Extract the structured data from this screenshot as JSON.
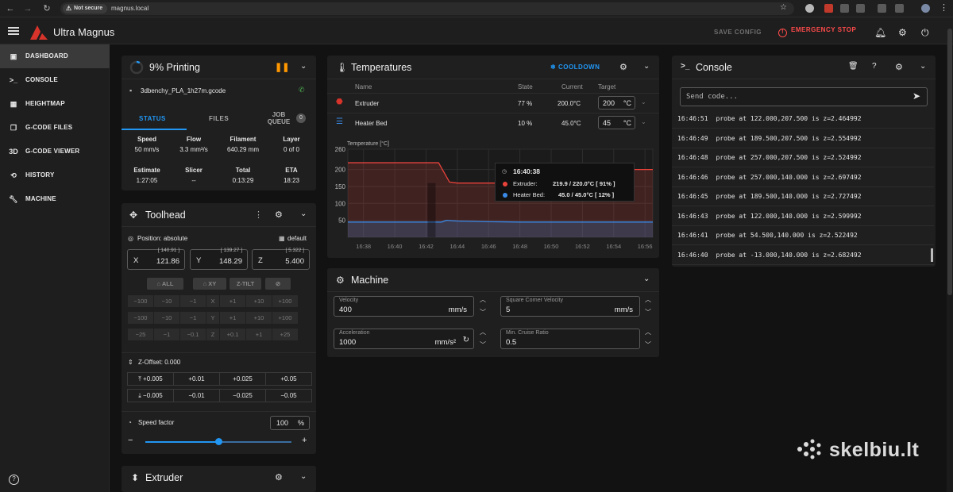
{
  "browser": {
    "security": "Not secure",
    "url": "magnus.local"
  },
  "header": {
    "app_title": "Ultra Magnus",
    "save_config": "SAVE CONFIG",
    "emergency_stop": "EMERGENCY STOP"
  },
  "sidebar": {
    "items": [
      {
        "label": "DASHBOARD",
        "icon": "dashboard-icon"
      },
      {
        "label": "CONSOLE",
        "icon": "console-icon"
      },
      {
        "label": "HEIGHTMAP",
        "icon": "grid-icon"
      },
      {
        "label": "G-CODE FILES",
        "icon": "files-icon"
      },
      {
        "label": "G-CODE VIEWER",
        "icon": "3d-icon",
        "icon_text": "3D"
      },
      {
        "label": "HISTORY",
        "icon": "history-icon"
      },
      {
        "label": "MACHINE",
        "icon": "wrench-icon"
      }
    ]
  },
  "status_panel": {
    "title": "9% Printing",
    "progress": 0.09,
    "filename": "3dbenchy_PLA_1h27m.gcode",
    "tabs": [
      "STATUS",
      "FILES",
      "JOB QUEUE"
    ],
    "job_queue_count": "0",
    "stats_row1": [
      {
        "label": "Speed",
        "value": "50 mm/s"
      },
      {
        "label": "Flow",
        "value": "3.3 mm³/s"
      },
      {
        "label": "Filament",
        "value": "640.29 mm"
      },
      {
        "label": "Layer",
        "value": "0 of 0"
      }
    ],
    "stats_row2": [
      {
        "label": "Estimate",
        "value": "1:27:05"
      },
      {
        "label": "Slicer",
        "value": "--"
      },
      {
        "label": "Total",
        "value": "0:13:29"
      },
      {
        "label": "ETA",
        "value": "18:23"
      }
    ]
  },
  "toolhead": {
    "title": "Toolhead",
    "position_label": "Position: absolute",
    "default_label": "default",
    "axes": [
      {
        "name": "X",
        "target": "[ 140.91 ]",
        "value": "121.86"
      },
      {
        "name": "Y",
        "target": "[ 139.27 ]",
        "value": "148.29"
      },
      {
        "name": "Z",
        "target": "[ 5.322 ]",
        "value": "5.400"
      }
    ],
    "home_buttons": [
      "ALL",
      "XY",
      "Z-TILT"
    ],
    "jog_rows": [
      [
        "−100",
        "−10",
        "−1",
        "X",
        "+1",
        "+10",
        "+100"
      ],
      [
        "−100",
        "−10",
        "−1",
        "Y",
        "+1",
        "+10",
        "+100"
      ],
      [
        "−25",
        "−1",
        "−0.1",
        "Z",
        "+0.1",
        "+1",
        "+25"
      ]
    ],
    "z_offset_label": "Z-Offset: 0.000",
    "z_up": [
      "+0.005",
      "+0.01",
      "+0.025",
      "+0.05"
    ],
    "z_down": [
      "−0.005",
      "−0.01",
      "−0.025",
      "−0.05"
    ],
    "speed_factor_label": "Speed factor",
    "speed_factor_value": "100",
    "speed_factor_unit": "%",
    "speed_factor_level": 0.5
  },
  "extruder_panel": {
    "title": "Extruder"
  },
  "temperatures": {
    "title": "Temperatures",
    "cooldown": "COOLDOWN",
    "columns": [
      "Name",
      "State",
      "Current",
      "Target"
    ],
    "rows": [
      {
        "name": "Extruder",
        "state": "77 %",
        "current": "200.0°C",
        "target": "200",
        "unit": "°C"
      },
      {
        "name": "Heater Bed",
        "state": "10 %",
        "current": "45.0°C",
        "target": "45",
        "unit": "°C"
      }
    ],
    "chart_label": "Temperature [°C]",
    "tooltip": {
      "time": "16:40:38",
      "rows": [
        {
          "name": "Extruder:",
          "value": "219.9 / 220.0°C [ 91% ]",
          "color": "#e8423b"
        },
        {
          "name": "Heater Bed:",
          "value": "45.0 / 45.0°C [ 12% ]",
          "color": "#3a8be8"
        }
      ]
    }
  },
  "chart_data": {
    "type": "line",
    "ylabel": "Temperature [°C]",
    "ylim": [
      0,
      260
    ],
    "yticks": [
      "260",
      "200",
      "150",
      "100",
      "50"
    ],
    "xticks": [
      "16:38",
      "16:40",
      "16:42",
      "16:44",
      "16:46",
      "16:48",
      "16:50",
      "16:52",
      "16:54",
      "16:56"
    ],
    "series": [
      {
        "name": "Extruder",
        "color": "#e8423b",
        "x": [
          "16:37",
          "16:38",
          "16:40",
          "16:42",
          "16:42.8",
          "16:43.5",
          "16:44",
          "16:46",
          "16:48",
          "16:50",
          "16:52",
          "16:53.5",
          "16:54",
          "16:56",
          "16:56.5"
        ],
        "values": [
          220,
          220,
          220,
          220,
          220,
          163,
          160,
          160,
          160,
          160,
          160,
          160,
          200,
          200,
          200
        ]
      },
      {
        "name": "Heater Bed",
        "color": "#3a8be8",
        "x": [
          "16:37",
          "16:38",
          "16:40",
          "16:42",
          "16:43",
          "16:43.3",
          "16:44",
          "16:46",
          "16:48",
          "16:50",
          "16:52",
          "16:54",
          "16:56",
          "16:56.5"
        ],
        "values": [
          45,
          45,
          45,
          45,
          45,
          50,
          48,
          46,
          45,
          45,
          45,
          45,
          45,
          45
        ]
      }
    ]
  },
  "machine": {
    "title": "Machine",
    "fields": [
      {
        "label": "Velocity",
        "value": "400",
        "unit": "mm/s"
      },
      {
        "label": "Square Corner Velocity",
        "value": "5",
        "unit": "mm/s"
      },
      {
        "label": "Acceleration",
        "value": "1000",
        "unit": "mm/s²"
      },
      {
        "label": "Min. Cruise Ratio",
        "value": "0.5",
        "unit": ""
      }
    ]
  },
  "console": {
    "title": "Console",
    "placeholder": "Send code...",
    "lines": [
      {
        "time": "16:46:51",
        "text": "probe at 122.000,207.500 is z=2.464992"
      },
      {
        "time": "16:46:49",
        "text": "probe at 189.500,207.500 is z=2.554992"
      },
      {
        "time": "16:46:48",
        "text": "probe at 257.000,207.500 is z=2.524992"
      },
      {
        "time": "16:46:46",
        "text": "probe at 257.000,140.000 is z=2.697492"
      },
      {
        "time": "16:46:45",
        "text": "probe at 189.500,140.000 is z=2.727492"
      },
      {
        "time": "16:46:43",
        "text": "probe at 122.000,140.000 is z=2.599992"
      },
      {
        "time": "16:46:41",
        "text": "probe at 54.500,140.000 is z=2.522492"
      },
      {
        "time": "16:46:40",
        "text": "probe at -13.000,140.000 is z=2.682492"
      }
    ]
  },
  "watermark": {
    "text": "skelbiu.lt"
  },
  "colors": {
    "accent": "#2196f3",
    "danger": "#ff4b4b",
    "warning": "#ff9800",
    "extruder": "#e8423b",
    "bed": "#3a8be8"
  }
}
